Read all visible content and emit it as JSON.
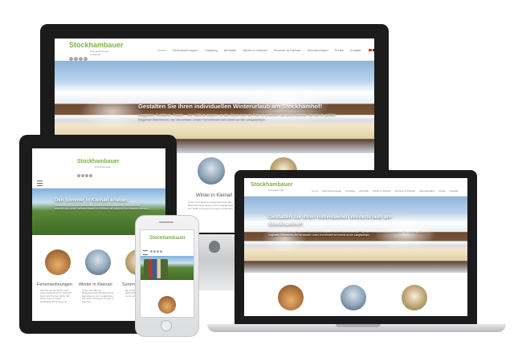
{
  "brand": {
    "name": "Stockhambauer",
    "tagline_line1": "Ferienwohnungen",
    "tagline_line2": "in Kleinarl"
  },
  "nav": [
    {
      "label": "Home",
      "active": true
    },
    {
      "label": "Ferienwohnungen"
    },
    {
      "label": "Camping"
    },
    {
      "label": "Almhütte"
    },
    {
      "label": "Winter in Kleinarl"
    },
    {
      "label": "Sommer in Kleinarl"
    },
    {
      "label": "Abenteuerland"
    },
    {
      "label": "Preise"
    },
    {
      "label": "Kontakt"
    }
  ],
  "desktop": {
    "hero_title": "Gestalten Sie ihren individuellen Winterurlaub am Stockhamhof!",
    "hero_text": "Langlaufen, Schifahren, Rodeln ... Der Skilift ist bequem mit den Skiern über die Piste zu erreichen und schon befinden Sie sich im größten Skigebiet Österreichs, der Ski amadé. Unser Hof befindet sich direkt an der Langlaufloipe.",
    "section_title": "Winter in Kleinarl",
    "section_text": "Unser mit 4 Blumen ausgezeichneter Bio-Bauernhof liegt direkt an der Langlaufloipe. Der Skilift ist bequem zu Fuß zu erreichen."
  },
  "tablet": {
    "hero_title": "Den Sommer in Kleinarl erleben",
    "hero_text": "Lassen Sie sich von der Wasserfaller Natur in Kleinarl inspirieren. Genießen Sie Wanderungen durch herrliche Wälder zur Kulturwie der Jägersee zum Beispiel Kleinarls.",
    "items": [
      {
        "title": "Ferienwohnungen",
        "text": "Sind Sie auf der Suche nach einem Appartement in Kleinarl? Dann sind Sie hier richtig. Wir bieten Ihnen 3 ruhige großzügige Wohnungen an."
      },
      {
        "title": "Winter in Kleinarl",
        "text": "Unser mit 4 Blumen ausgezeichneter Bio-Bauernhof liegt direkt an der Langlaufloipe. Der Skilift ist bequem zu Fuß zu erreichen."
      },
      {
        "title": "Sommer in Kleinarl",
        "text": "Die schönsten Seiten Österreichs erleben. Wie wäre es mit einer Wanderung?"
      }
    ]
  },
  "laptop": {
    "hero_title_line1": "Gestalten Sie ihren individuellen Winterurlaub am",
    "hero_title_line2": "Stockhamhof!",
    "hero_text": "Langlaufen, Schifahren, Rodeln ... Der Skilift ist bequem mit den Skiern über die Piste zu erreichen und schon befinden Sie sich im größten Skigebiet Österreichs, der Ski amadé. Unser Hof befindet sich direkt an der Langlaufloipe."
  },
  "colors": {
    "accent": "#7cb342",
    "device_dark": "#1b1b1b",
    "silver": "#d9dadc"
  }
}
